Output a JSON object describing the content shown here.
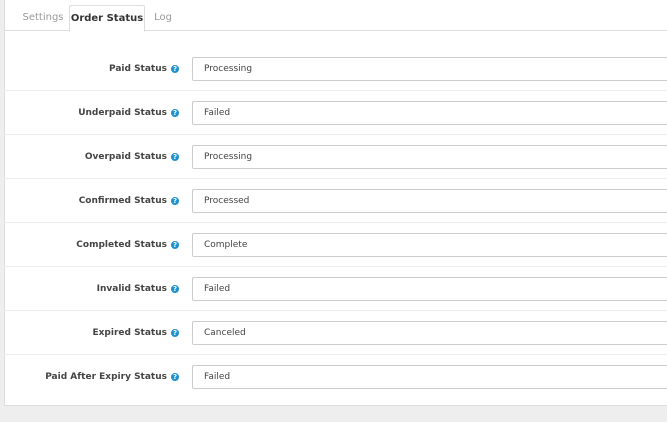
{
  "tabs": [
    {
      "label": "Settings",
      "active": false
    },
    {
      "label": "Order Status",
      "active": true
    },
    {
      "label": "Log",
      "active": false
    }
  ],
  "fields": [
    {
      "label": "Paid Status",
      "value": "Processing"
    },
    {
      "label": "Underpaid Status",
      "value": "Failed"
    },
    {
      "label": "Overpaid Status",
      "value": "Processing"
    },
    {
      "label": "Confirmed Status",
      "value": "Processed"
    },
    {
      "label": "Completed Status",
      "value": "Complete"
    },
    {
      "label": "Invalid Status",
      "value": "Failed"
    },
    {
      "label": "Expired Status",
      "value": "Canceled"
    },
    {
      "label": "Paid After Expiry Status",
      "value": "Failed"
    }
  ],
  "help_icon": "question-circle-icon",
  "colors": {
    "help_icon": "#1e91cf",
    "page_bg": "#eeeeee"
  }
}
